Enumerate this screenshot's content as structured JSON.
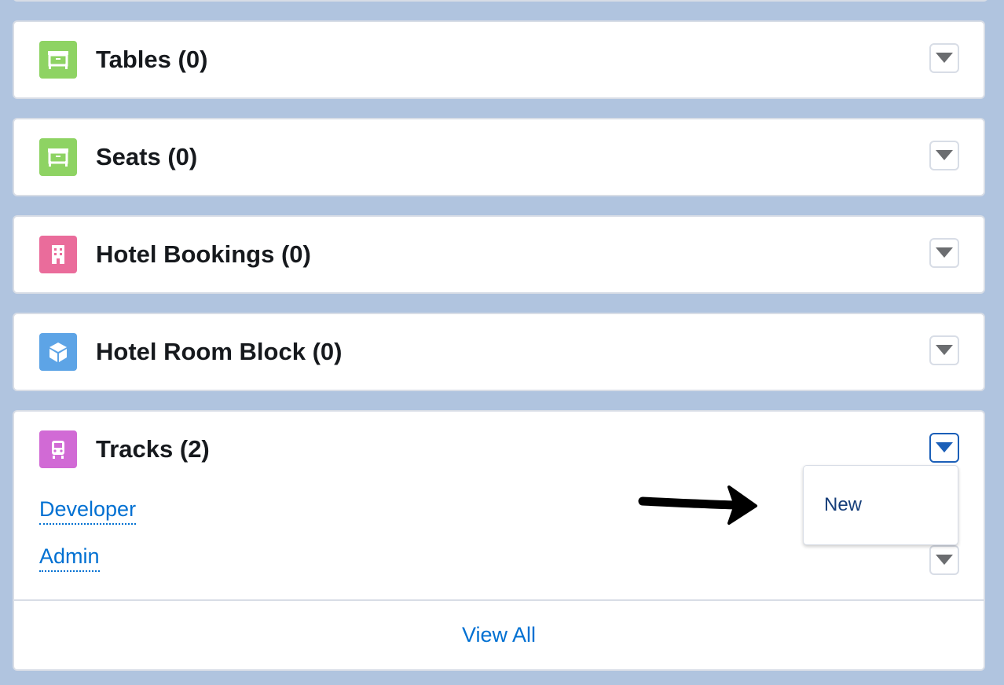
{
  "colors": {
    "background": "#b0c4df",
    "link": "#0070d2",
    "tables_icon": "#8ed363",
    "seats_icon": "#8ed363",
    "hotel_bookings_icon": "#ea6c9b",
    "hotel_room_block_icon": "#5da4e6",
    "tracks_icon": "#d16ad5"
  },
  "cards": [
    {
      "title": "Tables (0)",
      "icon": "desk-icon"
    },
    {
      "title": "Seats (0)",
      "icon": "desk-icon"
    },
    {
      "title": "Hotel Bookings (0)",
      "icon": "building-icon"
    },
    {
      "title": "Hotel Room Block (0)",
      "icon": "cube-icon"
    },
    {
      "title": "Tracks (2)",
      "icon": "train-icon"
    }
  ],
  "tracks": {
    "records": [
      "Developer",
      "Admin"
    ],
    "view_all": "View All",
    "menu": {
      "items": [
        "New"
      ]
    }
  }
}
